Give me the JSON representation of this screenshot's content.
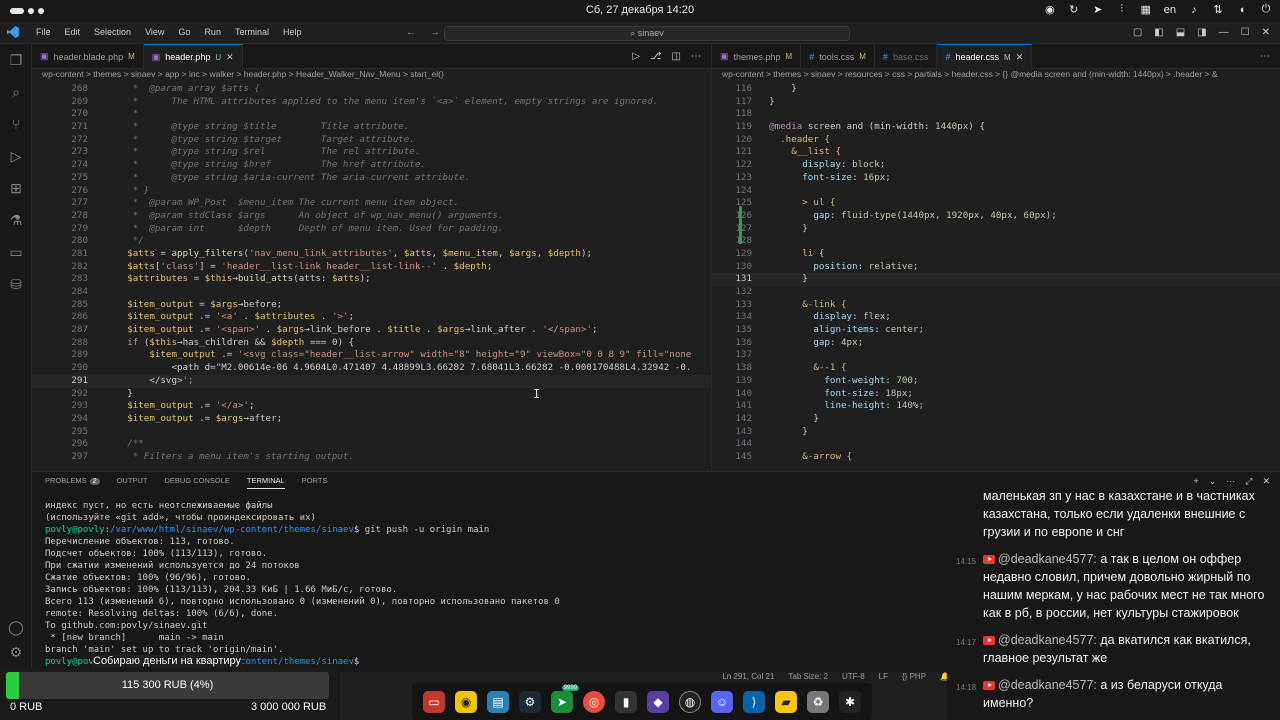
{
  "system": {
    "clock": "Сб, 27 декабря  14:20",
    "lang": "en"
  },
  "window": {
    "menu": [
      "File",
      "Edit",
      "Selection",
      "View",
      "Go",
      "Run",
      "Terminal",
      "Help"
    ],
    "search": "sinaev"
  },
  "left_editor": {
    "tabs": [
      {
        "name": "header.blade.php",
        "flag": "M",
        "active": false
      },
      {
        "name": "header.php",
        "flag": "U",
        "active": true
      }
    ],
    "breadcrumb": "wp-content > themes > sinaev > app > inc > walker > header.php > Header_Walker_Nav_Menu > start_el()",
    "lines": [
      {
        "n": "268",
        "t": "       *  @param array $atts {"
      },
      {
        "n": "269",
        "t": "       *      The HTML attributes applied to the menu item's `<a>` element, empty strings are ignored."
      },
      {
        "n": "270",
        "t": "       *"
      },
      {
        "n": "271",
        "t": "       *      @type string $title        Title attribute."
      },
      {
        "n": "272",
        "t": "       *      @type string $target       Target attribute."
      },
      {
        "n": "273",
        "t": "       *      @type string $rel          The rel attribute."
      },
      {
        "n": "274",
        "t": "       *      @type string $href         The href attribute."
      },
      {
        "n": "275",
        "t": "       *      @type string $aria-current The aria-current attribute."
      },
      {
        "n": "276",
        "t": "       * }"
      },
      {
        "n": "277",
        "t": "       *  @param WP_Post  $menu_item The current menu item object."
      },
      {
        "n": "278",
        "t": "       *  @param stdClass $args      An object of wp_nav_menu() arguments."
      },
      {
        "n": "279",
        "t": "       *  @param int      $depth     Depth of menu item. Used for padding."
      },
      {
        "n": "280",
        "t": "       */"
      },
      {
        "n": "281",
        "t": "      $atts = apply_filters('nav_menu_link_attributes', $atts, $menu_item, $args, $depth);"
      },
      {
        "n": "282",
        "t": "      $atts['class'] = 'header__list-link header__list-link--' . $depth;"
      },
      {
        "n": "283",
        "t": "      $attributes = $this→build_atts(atts: $atts);"
      },
      {
        "n": "284",
        "t": ""
      },
      {
        "n": "285",
        "t": "      $item_output = $args→before;"
      },
      {
        "n": "286",
        "t": "      $item_output .= '<a' . $attributes . '>';"
      },
      {
        "n": "287",
        "t": "      $item_output .= '<span>' . $args→link_before . $title . $args→link_after . '</span>';"
      },
      {
        "n": "288",
        "t": "      if ($this→has_children && $depth === 0) {"
      },
      {
        "n": "289",
        "t": "          $item_output .= '<svg class=\"header__list-arrow\" width=\"8\" height=\"9\" viewBox=\"0 0 8 9\" fill=\"none"
      },
      {
        "n": "290",
        "t": "              <path d=\"M2.00614e-06 4.9604L0.471407 4.48899L3.66282 7.68041L3.66282 -0.000170488L4.32942 -0."
      },
      {
        "n": "291",
        "t": "          </svg>';"
      },
      {
        "n": "292",
        "t": "      }"
      },
      {
        "n": "293",
        "t": "      $item_output .= '</a>';"
      },
      {
        "n": "294",
        "t": "      $item_output .= $args→after;"
      },
      {
        "n": "295",
        "t": ""
      },
      {
        "n": "296",
        "t": "      /**"
      },
      {
        "n": "297",
        "t": "       * Filters a menu item's starting output."
      }
    ]
  },
  "right_editor": {
    "tabs": [
      {
        "name": "themes.php",
        "flag": "M",
        "active": false
      },
      {
        "name": "tools.css",
        "flag": "M",
        "active": false
      },
      {
        "name": "base.css",
        "flag": "",
        "active": false
      },
      {
        "name": "header.css",
        "flag": "M",
        "active": true
      }
    ],
    "breadcrumb": "wp-content > themes > sinaev > resources > css > partials > header.css > {} @media screen and (min-width: 1440px) > .header > &",
    "lines": [
      {
        "n": "116",
        "t": "      }"
      },
      {
        "n": "117",
        "t": "  }"
      },
      {
        "n": "118",
        "t": ""
      },
      {
        "n": "119",
        "t": "  @media screen and (min-width: 1440px) {"
      },
      {
        "n": "120",
        "t": "    .header {"
      },
      {
        "n": "121",
        "t": "      &__list {"
      },
      {
        "n": "122",
        "t": "        display: block;"
      },
      {
        "n": "123",
        "t": "        font-size: 16px;"
      },
      {
        "n": "124",
        "t": ""
      },
      {
        "n": "125",
        "t": "        > ul {"
      },
      {
        "n": "126",
        "t": "          gap: fluid-type(1440px, 1920px, 40px, 60px);"
      },
      {
        "n": "127",
        "t": "        }"
      },
      {
        "n": "128",
        "t": ""
      },
      {
        "n": "129",
        "t": "        li {"
      },
      {
        "n": "130",
        "t": "          position: relative;"
      },
      {
        "n": "131",
        "t": "        }"
      },
      {
        "n": "132",
        "t": ""
      },
      {
        "n": "133",
        "t": "        &-link {"
      },
      {
        "n": "134",
        "t": "          display: flex;"
      },
      {
        "n": "135",
        "t": "          align-items: center;"
      },
      {
        "n": "136",
        "t": "          gap: 4px;"
      },
      {
        "n": "137",
        "t": ""
      },
      {
        "n": "138",
        "t": "          &--1 {"
      },
      {
        "n": "139",
        "t": "            font-weight: 700;"
      },
      {
        "n": "140",
        "t": "            font-size: 18px;"
      },
      {
        "n": "141",
        "t": "            line-height: 140%;"
      },
      {
        "n": "142",
        "t": "          }"
      },
      {
        "n": "143",
        "t": "        }"
      },
      {
        "n": "144",
        "t": ""
      },
      {
        "n": "145",
        "t": "        &-arrow {"
      }
    ]
  },
  "panel": {
    "tabs": [
      {
        "label": "PROBLEMS",
        "badge": "2"
      },
      {
        "label": "OUTPUT"
      },
      {
        "label": "DEBUG CONSOLE"
      },
      {
        "label": "TERMINAL",
        "active": true
      },
      {
        "label": "PORTS"
      }
    ],
    "terminal": [
      "индекс пуст, но есть неотслеживаемые файлы",
      "(используйте «git add», чтобы проиндексировать их)",
      "povly@povly:/var/www/html/sinaev/wp-content/themes/sinaev$ git push -u origin main",
      "Перечисление объектов: 113, готово.",
      "Подсчет объектов: 100% (113/113), готово.",
      "При сжатии изменений используется до 24 потоков",
      "Сжатие объектов: 100% (96/96), готово.",
      "Запись объектов: 100% (113/113), 204.33 КиБ | 1.66 МиБ/с, готово.",
      "Всего 113 (изменений 6), повторно использовано 0 (изменений 0), повторно использовано пакетов 0",
      "remote: Resolving deltas: 100% (6/6), done.",
      "To github.com:povly/sinaev.git",
      " * [new branch]      main -> main",
      "branch 'main' set up to track 'origin/main'.",
      "povly@povly:/var/www/html/sinaev/wp-content/themes/sinaev$ "
    ]
  },
  "statusbar": {
    "position": "Ln 291, Col 21",
    "tab": "Tab Size: 2",
    "enc": "UTF-8",
    "eol": "LF",
    "lang": "PHP"
  },
  "chat": [
    {
      "time": "",
      "user": "",
      "text": "маленькая зп у нас в казахстане и в частниках казахстана, только если удаленки внешние с грузии и по европе и снг"
    },
    {
      "time": "14:15",
      "user": "@deadkane4577:",
      "text": "а так в целом он оффер недавно словил, причем довольно жирный по нашим меркам, у нас рабочих мест не так много как в рб, в россии, нет культуры стажировок"
    },
    {
      "time": "14:17",
      "user": "@deadkane4577:",
      "text": "да вкатился как вкатился, главное результат же"
    },
    {
      "time": "14:18",
      "user": "@deadkane4577:",
      "text": "а из беларуси откуда именно?"
    }
  ],
  "donation": {
    "title": "Собираю деньги на квартиру",
    "progress_text": "115 300 RUB (4%)",
    "progress": 0.04,
    "min": "0 RUB",
    "max": "3 000 000 RUB"
  },
  "dock": {
    "badge": "9999"
  }
}
